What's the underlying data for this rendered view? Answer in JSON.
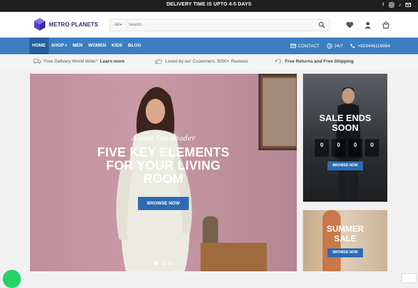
{
  "topbar": {
    "delivery_text": "DELIVERY TIME IS UPTO 4-5 DAYS",
    "social": [
      "facebook-icon",
      "instagram-icon",
      "tiktok-icon",
      "email-icon"
    ]
  },
  "header": {
    "logo_text": "METRO PLANETS",
    "search": {
      "category": "All",
      "placeholder": "Search..."
    },
    "icons": [
      "heart-icon",
      "user-icon",
      "cart-icon"
    ]
  },
  "nav": {
    "items": [
      "HOME",
      "SHOP",
      "MEN",
      "WOMEN",
      "KIDS",
      "BLOG"
    ],
    "active": "HOME",
    "contact_label": "CONTACT",
    "hours_label": "24/7",
    "phone": "+923446116984"
  },
  "features": {
    "f1_text": "Free Delivery World Wide*",
    "f1_link": "Learn more",
    "f2_text": "Loved by our Customers, 5000+ Reviews",
    "f3_text": "Free Returns and Free Shipping"
  },
  "hero": {
    "tagline": "A cool Top header",
    "title_line1": "FIVE KEY ELEMENTS",
    "title_line2": "FOR YOUR LIVING",
    "title_line3": "ROOM",
    "button_label": "BROWSE NOW",
    "slides": 3,
    "active_slide": 1
  },
  "promo_sale": {
    "small_text": "",
    "title_line1": "SALE ENDS",
    "title_line2": "SOON",
    "countdown": [
      {
        "value": "0",
        "unit": ""
      },
      {
        "value": "0",
        "unit": ""
      },
      {
        "value": "0",
        "unit": ""
      },
      {
        "value": "0",
        "unit": ""
      }
    ],
    "button_label": "BROWSE NOW"
  },
  "promo_summer": {
    "title_line1": "SUMMER",
    "title_line2": "SALE",
    "button_label": "BROWSE NOW"
  },
  "colors": {
    "nav": "#3c7fc1",
    "button": "#2c6bb3",
    "topbar": "#1e1e1e",
    "whatsapp": "#25d366"
  }
}
